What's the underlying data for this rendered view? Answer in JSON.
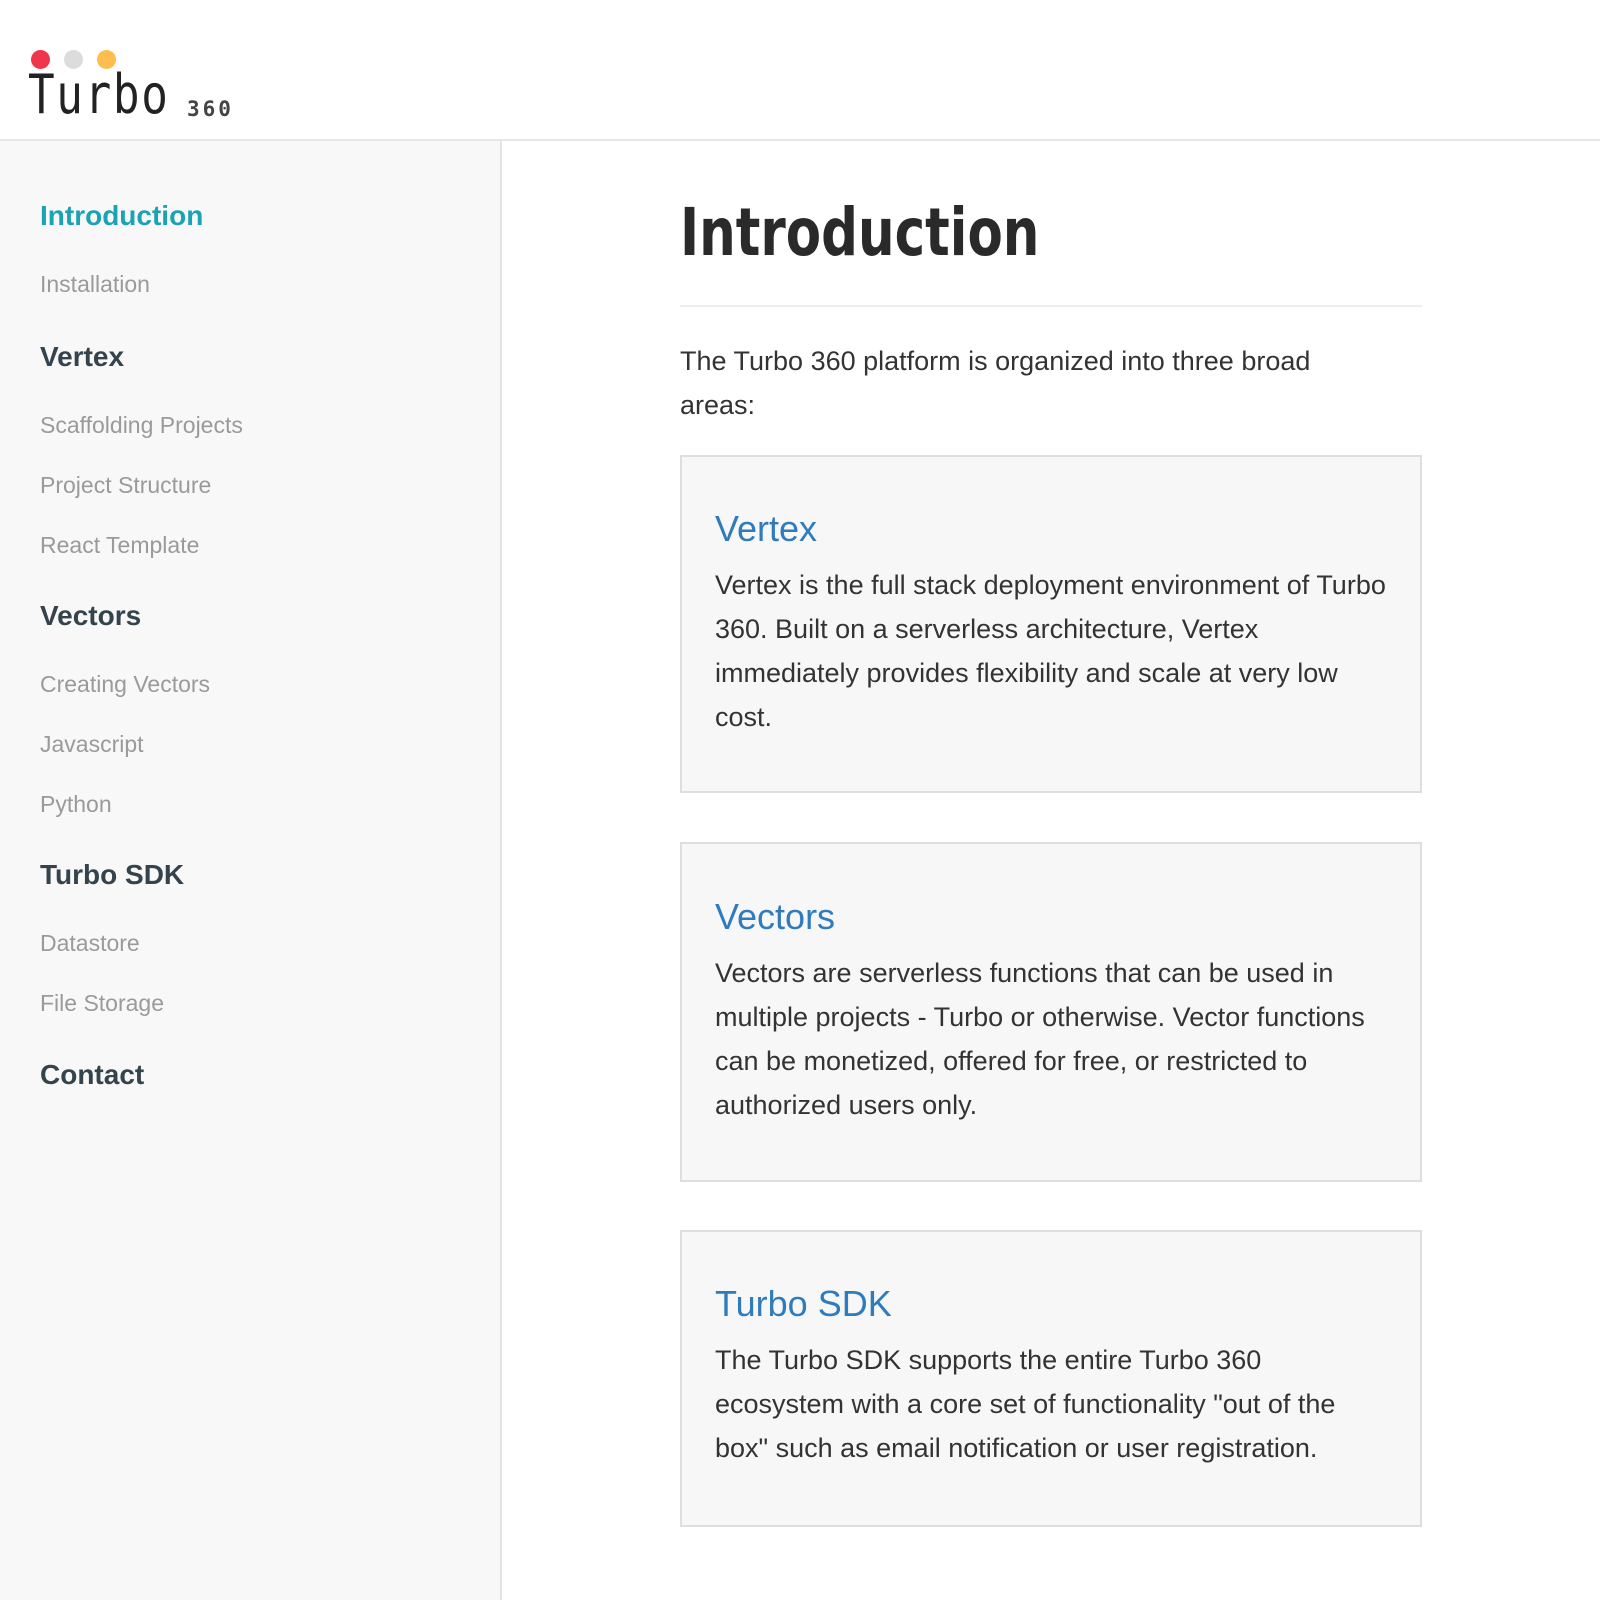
{
  "header": {
    "logo_text": "Turbo",
    "logo_sub": "360",
    "dots": [
      {
        "name": "red",
        "color": "#f1354b"
      },
      {
        "name": "grey",
        "color": "#dcdcdc"
      },
      {
        "name": "yellow",
        "color": "#fdbe4f"
      }
    ]
  },
  "sidebar": {
    "items": [
      {
        "label": "Introduction",
        "type": "section",
        "active": true
      },
      {
        "label": "Installation",
        "type": "sub"
      },
      {
        "label": "Vertex",
        "type": "section"
      },
      {
        "label": "Scaffolding Projects",
        "type": "sub"
      },
      {
        "label": "Project Structure",
        "type": "sub"
      },
      {
        "label": "React Template",
        "type": "sub"
      },
      {
        "label": "Vectors",
        "type": "section"
      },
      {
        "label": "Creating Vectors",
        "type": "sub"
      },
      {
        "label": "Javascript",
        "type": "sub"
      },
      {
        "label": "Python",
        "type": "sub"
      },
      {
        "label": "Turbo SDK",
        "type": "section"
      },
      {
        "label": "Datastore",
        "type": "sub"
      },
      {
        "label": "File Storage",
        "type": "sub"
      },
      {
        "label": "Contact",
        "type": "section"
      }
    ]
  },
  "main": {
    "title": "Introduction",
    "intro": "The Turbo 360 platform is organized into three broad areas:",
    "cards": [
      {
        "title": "Vertex",
        "body": "Vertex is the full stack deployment environment of Turbo 360. Built on a serverless architecture, Vertex immediately provides flexibility and scale at very low cost."
      },
      {
        "title": "Vectors",
        "body": "Vectors are serverless functions that can be used in multiple projects - Turbo or otherwise. Vector functions can be monetized, offered for free, or restricted to authorized users only."
      },
      {
        "title": "Turbo SDK",
        "body": "The Turbo SDK supports the entire Turbo 360 ecosystem with a core set of functionality \"out of the box\" such as email notification or user registration."
      }
    ]
  },
  "colors": {
    "accent": "#1aa3b5",
    "link": "#2e7bbd",
    "section_text": "#34434c",
    "sub_text": "#9a9a9a"
  }
}
